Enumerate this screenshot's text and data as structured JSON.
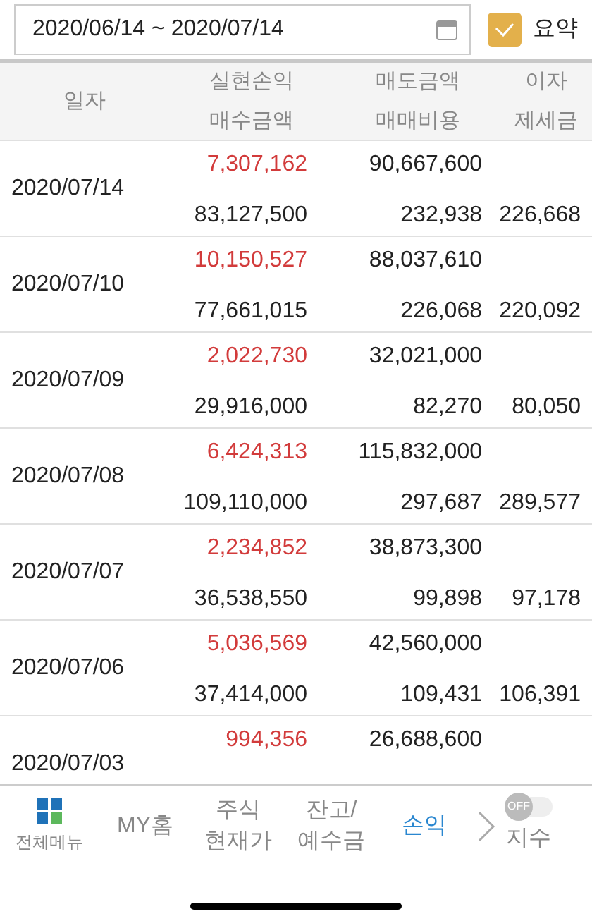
{
  "date_range": {
    "value": "2020/06/14 ~ 2020/07/14"
  },
  "summary": {
    "label": "요약",
    "checked": true
  },
  "table": {
    "columns": [
      {
        "top": "일자"
      },
      {
        "top": "실현손익",
        "bottom": "매수금액"
      },
      {
        "top": "매도금액",
        "bottom": "매매비용"
      },
      {
        "top": "이자",
        "bottom": "제세금"
      }
    ],
    "rows": [
      {
        "date": "2020/07/14",
        "profit": "7,307,162",
        "sell": "90,667,600",
        "buy": "83,127,500",
        "cost": "232,938",
        "tax": "226,668"
      },
      {
        "date": "2020/07/10",
        "profit": "10,150,527",
        "sell": "88,037,610",
        "buy": "77,661,015",
        "cost": "226,068",
        "tax": "220,092"
      },
      {
        "date": "2020/07/09",
        "profit": "2,022,730",
        "sell": "32,021,000",
        "buy": "29,916,000",
        "cost": "82,270",
        "tax": "80,050"
      },
      {
        "date": "2020/07/08",
        "profit": "6,424,313",
        "sell": "115,832,000",
        "buy": "109,110,000",
        "cost": "297,687",
        "tax": "289,577"
      },
      {
        "date": "2020/07/07",
        "profit": "2,234,852",
        "sell": "38,873,300",
        "buy": "36,538,550",
        "cost": "99,898",
        "tax": "97,178"
      },
      {
        "date": "2020/07/06",
        "profit": "5,036,569",
        "sell": "42,560,000",
        "buy": "37,414,000",
        "cost": "109,431",
        "tax": "106,391"
      },
      {
        "date": "2020/07/03",
        "profit": "994,356",
        "sell": "26,688,600"
      }
    ]
  },
  "nav": {
    "items": [
      {
        "kind": "grid",
        "label": "전체메뉴",
        "selected": false
      },
      {
        "kind": "text",
        "label": "MY홈",
        "selected": false
      },
      {
        "kind": "text",
        "label": "주식\n현재가",
        "selected": false
      },
      {
        "kind": "text",
        "label": "잔고/\n예수금",
        "selected": false
      },
      {
        "kind": "text",
        "label": "손익",
        "selected": true
      }
    ],
    "toggle": {
      "label": "OFF",
      "on": false
    },
    "index_label": "지수"
  }
}
